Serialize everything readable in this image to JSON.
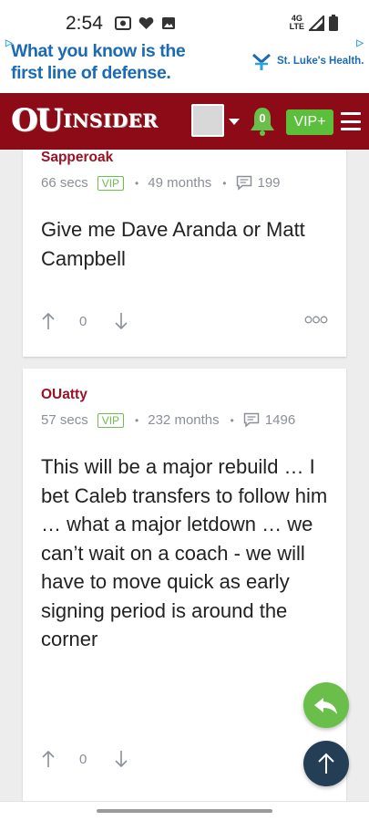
{
  "status_bar": {
    "time": "2:54",
    "network_top": "4G",
    "network_bottom": "LTE"
  },
  "ad": {
    "text": "What you know is the first line of defense.",
    "sponsor": "St. Luke's Health.",
    "colors": {
      "text": "#1c6ab3",
      "choices": "#2aa3e0"
    }
  },
  "header": {
    "logo_ou": "OU",
    "logo_insider": "INSIDER",
    "notification_count": "0",
    "vip_label": "VIP+",
    "colors": {
      "background": "#8c0b17",
      "vip": "#5bbf3c"
    }
  },
  "posts": [
    {
      "username": "Sapperoak",
      "time": "66 secs",
      "badge": "VIP",
      "membership": "49 months",
      "comment_count": "199",
      "body": "Give me Dave Aranda or Matt Campbell",
      "votes": "0"
    },
    {
      "username": "OUatty",
      "time": "57 secs",
      "badge": "VIP",
      "membership": "232 months",
      "comment_count": "1496",
      "body": "This will be a major rebuild … I bet Caleb transfers to follow him … what a major letdown … we can’t wait on a coach - we will have to move quick as early signing period is around the corner",
      "votes": "0"
    }
  ],
  "colors": {
    "username": "#9b1224",
    "reply_fab": "#6abf4b",
    "top_fab": "#243e56"
  }
}
